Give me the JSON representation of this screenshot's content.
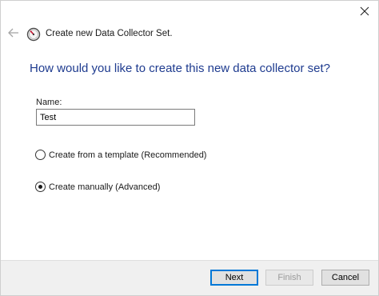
{
  "window": {
    "title": "Create new Data Collector Set."
  },
  "heading": "How would you like to create this new data collector set?",
  "name_field": {
    "label": "Name:",
    "value": "Test"
  },
  "options": [
    {
      "label": "Create from a template (Recommended)",
      "selected": false
    },
    {
      "label": "Create manually (Advanced)",
      "selected": true
    }
  ],
  "buttons": {
    "next": "Next",
    "finish": "Finish",
    "cancel": "Cancel"
  },
  "icons": {
    "close": "close-icon",
    "back": "back-arrow-icon",
    "app": "performance-monitor-icon"
  },
  "colors": {
    "heading": "#1e3b8f",
    "primary_border": "#0078d7",
    "footer_bg": "#f0f0f0"
  }
}
